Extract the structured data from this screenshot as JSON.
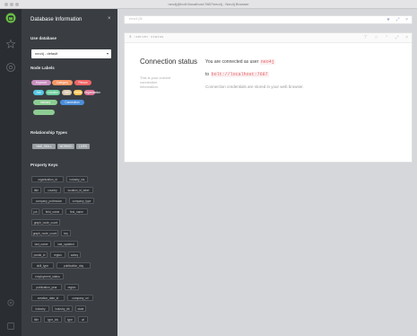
{
  "window": {
    "title": "neo4j@bolt://localhost:7687/neo4j - Neo4j Browser"
  },
  "sidebar": {
    "title": "Database Information",
    "use_database_label": "Use database",
    "database_selected": "neo4j - default",
    "node_labels_heading": "Node Labels",
    "node_labels": [
      {
        "label": "Keyword",
        "color": "#c990c0"
      },
      {
        "label": "Category",
        "color": "#f79767"
      },
      {
        "label": "Person",
        "color": "#f16667"
      },
      {
        "label": "Job",
        "color": "#57c7e3"
      },
      {
        "label": "Location",
        "color": "#6dce9e"
      },
      {
        "label": "Skill",
        "color": "#d9c8ae"
      },
      {
        "label": "Fields",
        "color": "#ffc454"
      },
      {
        "label": "Organization",
        "color": "#da7194"
      },
      {
        "label": "Industry",
        "color": "#8dcc93"
      },
      {
        "label": "Connection",
        "color": "#4c8eda"
      }
    ],
    "relationship_types_heading": "Relationship Types",
    "relationship_types": [
      "HAS_SKILL",
      "WORKED",
      "LIVES"
    ],
    "property_keys_heading": "Property Keys",
    "property_keys": [
      "organization_id",
      "industry_ids",
      "title",
      "country",
      "location_id_label",
      "company_profession",
      "company_type",
      "job",
      "field_name",
      "first_name",
      "graph_node_count",
      "graph_node_count",
      "key",
      "last_name",
      "last_updated",
      "postal_id",
      "region",
      "salary",
      "skill_type",
      "publication_day",
      "employment_status",
      "publication_year",
      "region",
      "creation_date_id",
      "company_url",
      "industry",
      "industry_db",
      "state",
      "title",
      "type_ids",
      "type",
      "url"
    ]
  },
  "editor": {
    "placeholder": "neo4j$",
    "icons": [
      "star-icon",
      "expand-icon",
      "close-icon"
    ]
  },
  "frame": {
    "command": "$ :server status",
    "heading": "Connection status",
    "subtext": "This is your current connection information.",
    "line1_prefix": "You are connected as user",
    "user": "neo4j",
    "line2_prefix": "to",
    "url": "bolt://localhost:7687",
    "line3": "Connection credentials are stored in your web browser."
  }
}
